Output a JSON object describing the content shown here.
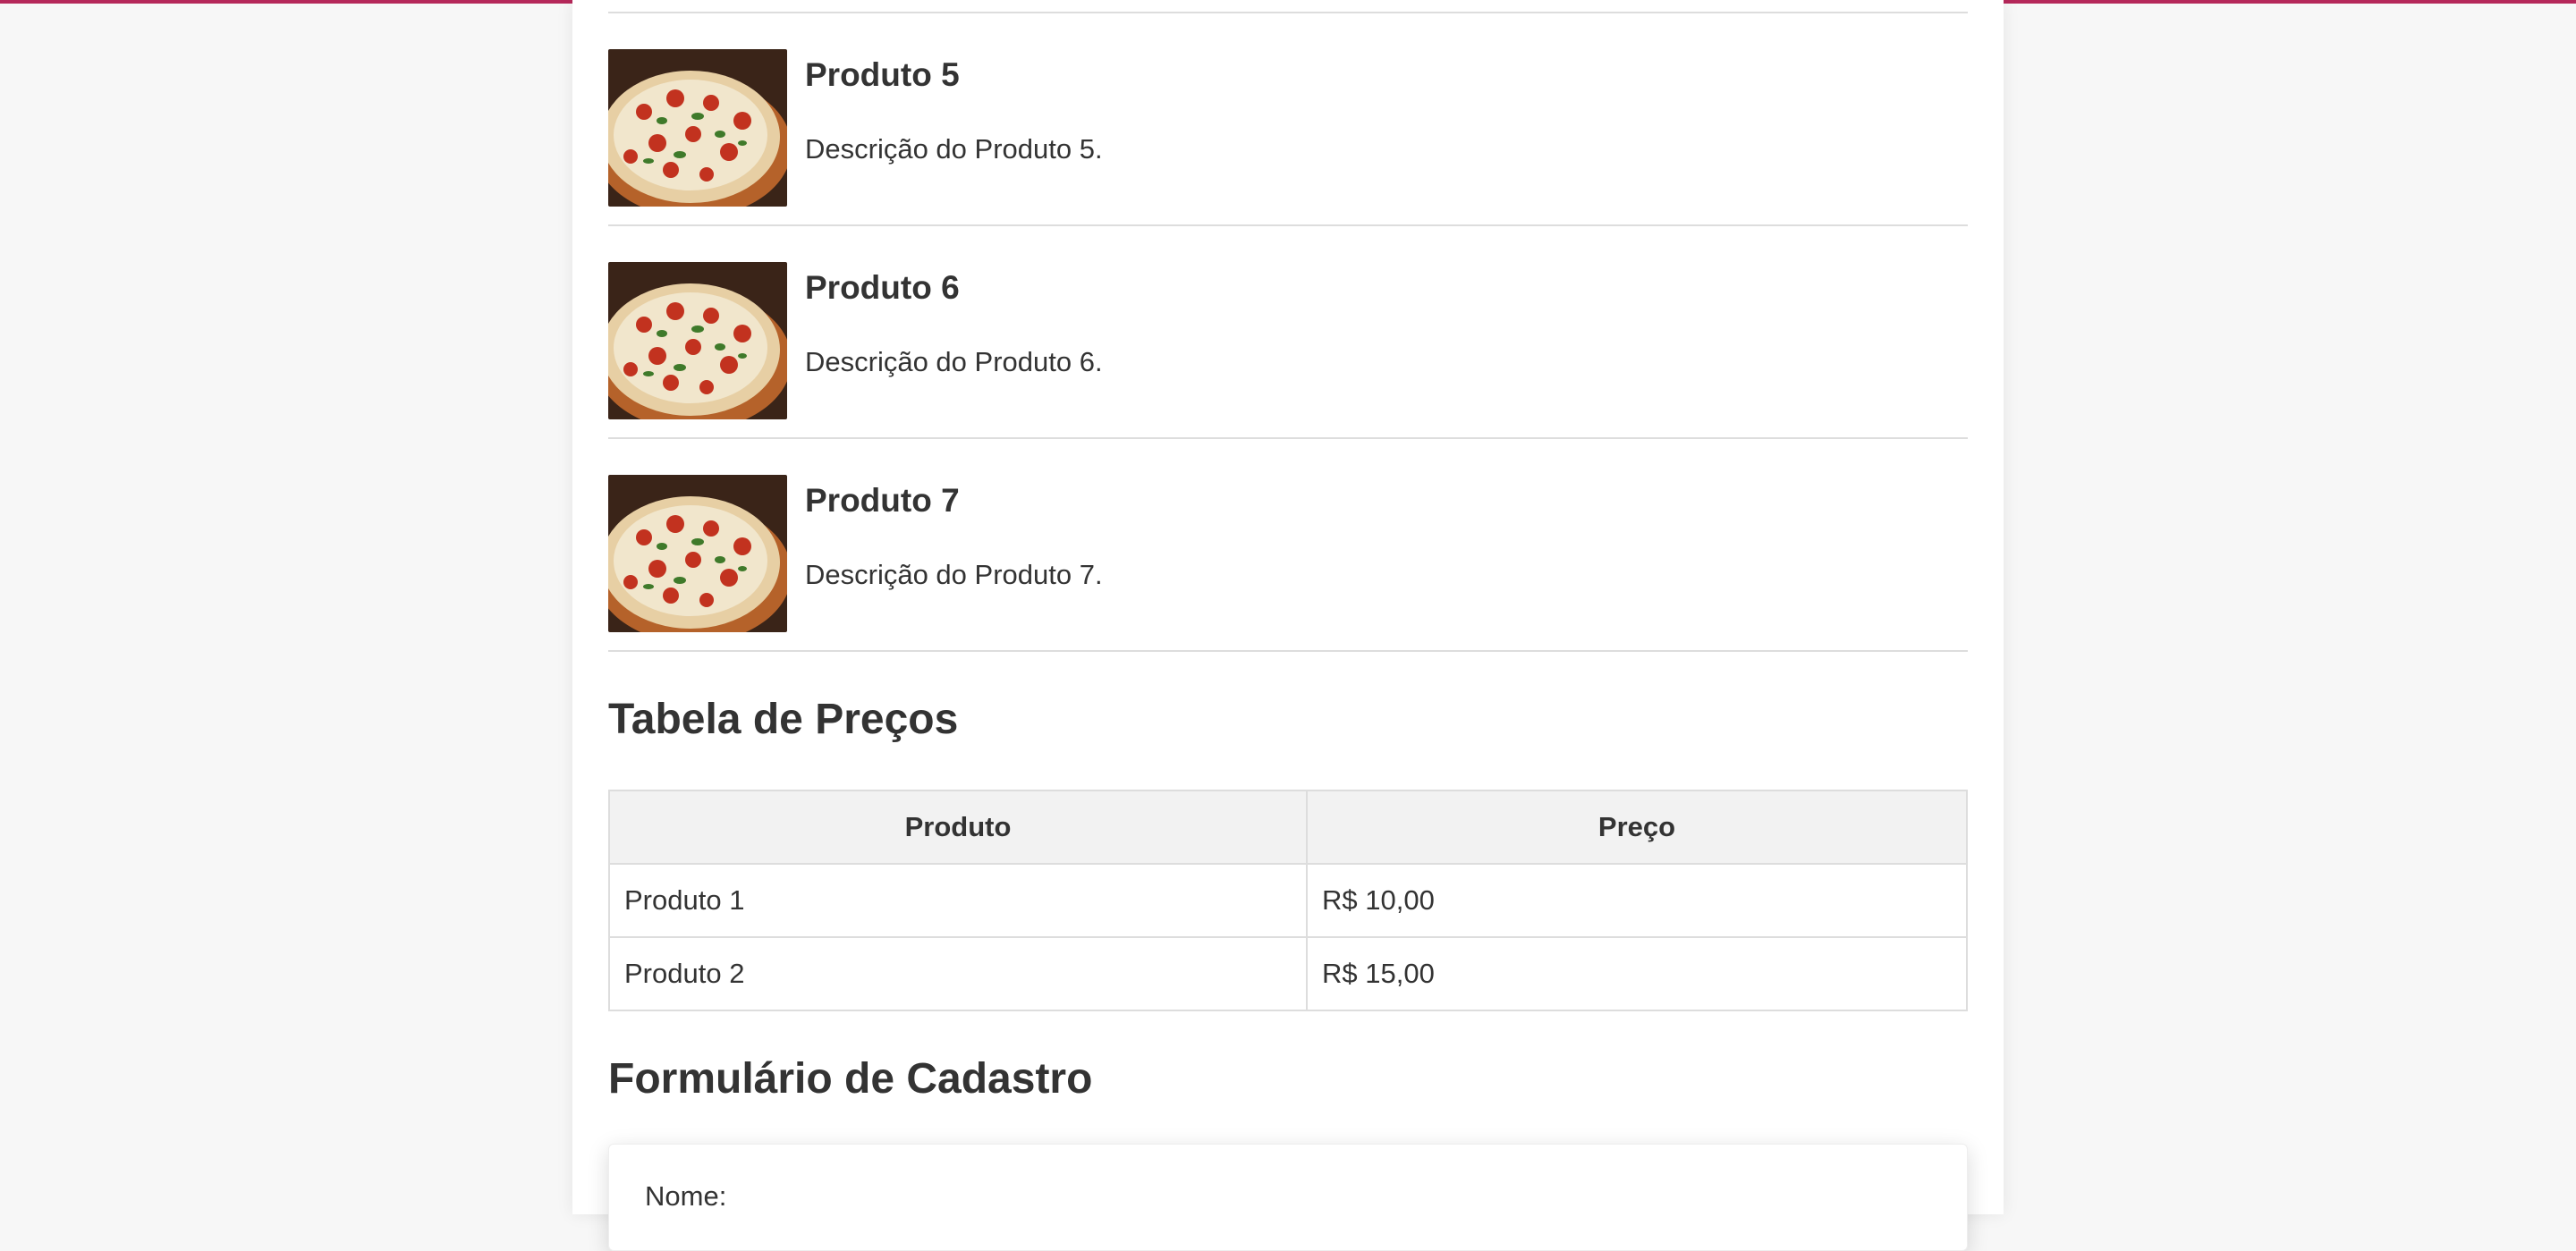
{
  "theme": {
    "accent": "#b5285a",
    "background": "#f7f7f7",
    "card": "#ffffff",
    "border": "#dddddd",
    "header_bg": "#f2f2f2",
    "text": "#333333"
  },
  "products": [
    {
      "title": "Produto 5",
      "description": "Descrição do Produto 5.",
      "image": "pizza-image"
    },
    {
      "title": "Produto 6",
      "description": "Descrição do Produto 6.",
      "image": "pizza-image"
    },
    {
      "title": "Produto 7",
      "description": "Descrição do Produto 7.",
      "image": "pizza-image"
    }
  ],
  "price_table": {
    "title": "Tabela de Preços",
    "headers": [
      "Produto",
      "Preço"
    ],
    "rows": [
      [
        "Produto 1",
        "R$ 10,00"
      ],
      [
        "Produto 2",
        "R$ 15,00"
      ]
    ]
  },
  "form": {
    "title": "Formulário de Cadastro",
    "name_label": "Nome:"
  }
}
